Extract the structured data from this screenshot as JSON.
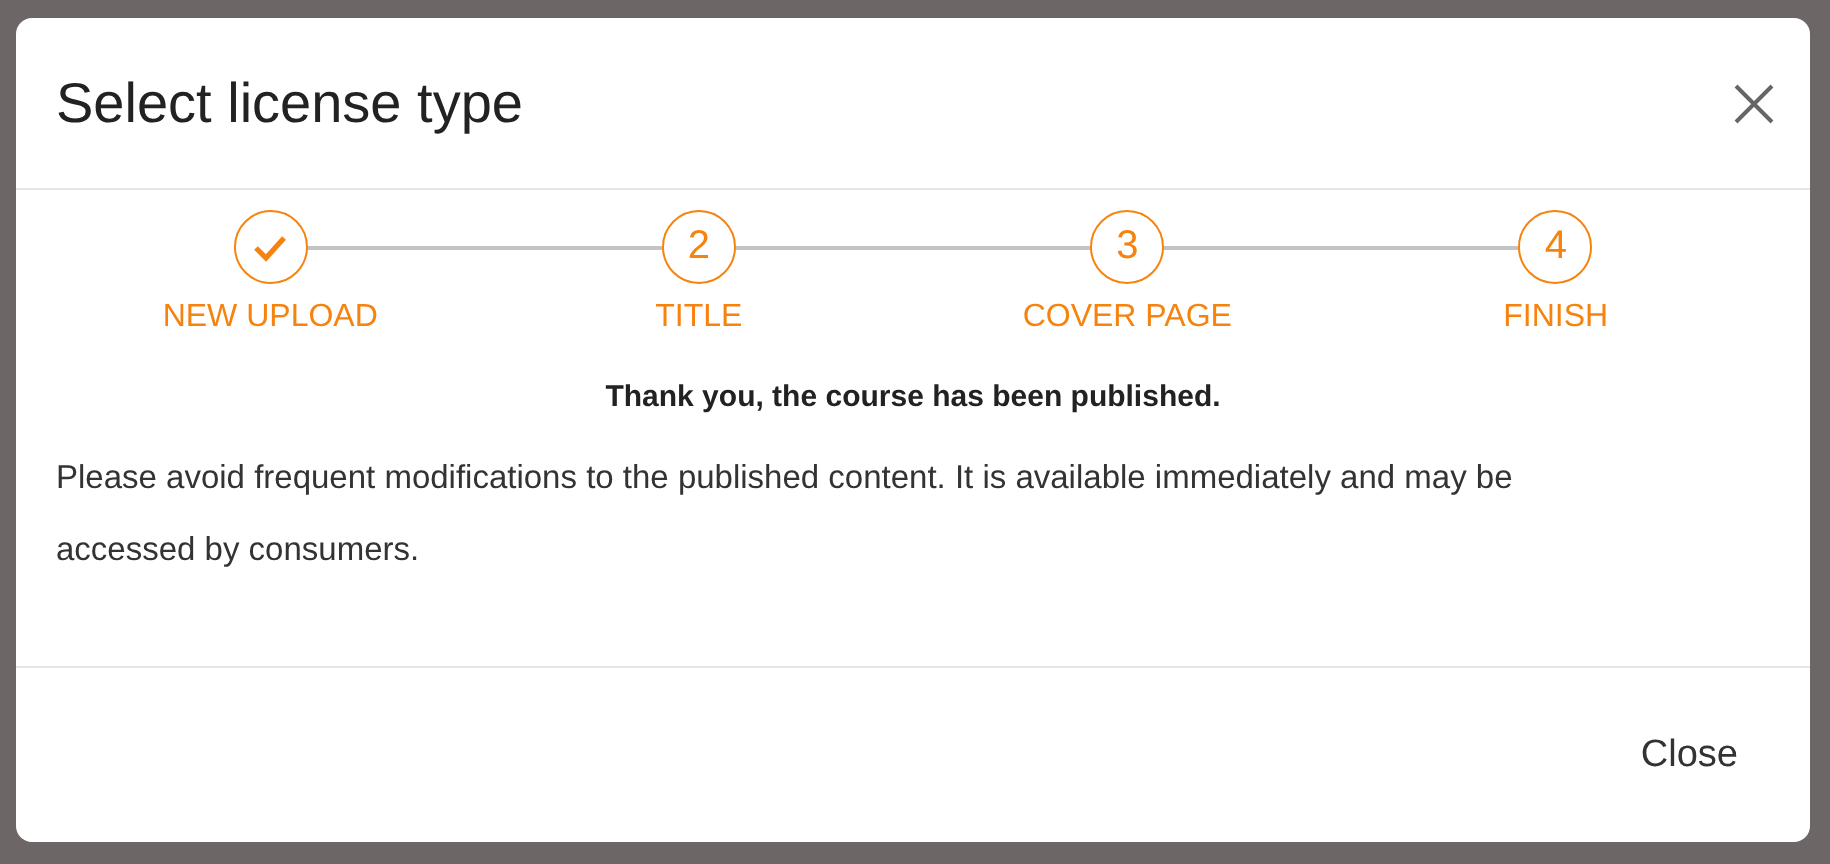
{
  "dialog": {
    "title": "Select license type"
  },
  "steps": [
    {
      "label": "NEW UPLOAD",
      "done": true
    },
    {
      "number": "2",
      "label": "TITLE",
      "done": false
    },
    {
      "number": "3",
      "label": "COVER PAGE",
      "done": false
    },
    {
      "number": "4",
      "label": "FINISH",
      "done": false
    }
  ],
  "message": {
    "heading": "Thank you, the course has been published.",
    "body": "Please avoid frequent modifications to the published content. It is available immediately and may be accessed by consumers."
  },
  "buttons": [
    {
      "label": "Close"
    }
  ]
}
